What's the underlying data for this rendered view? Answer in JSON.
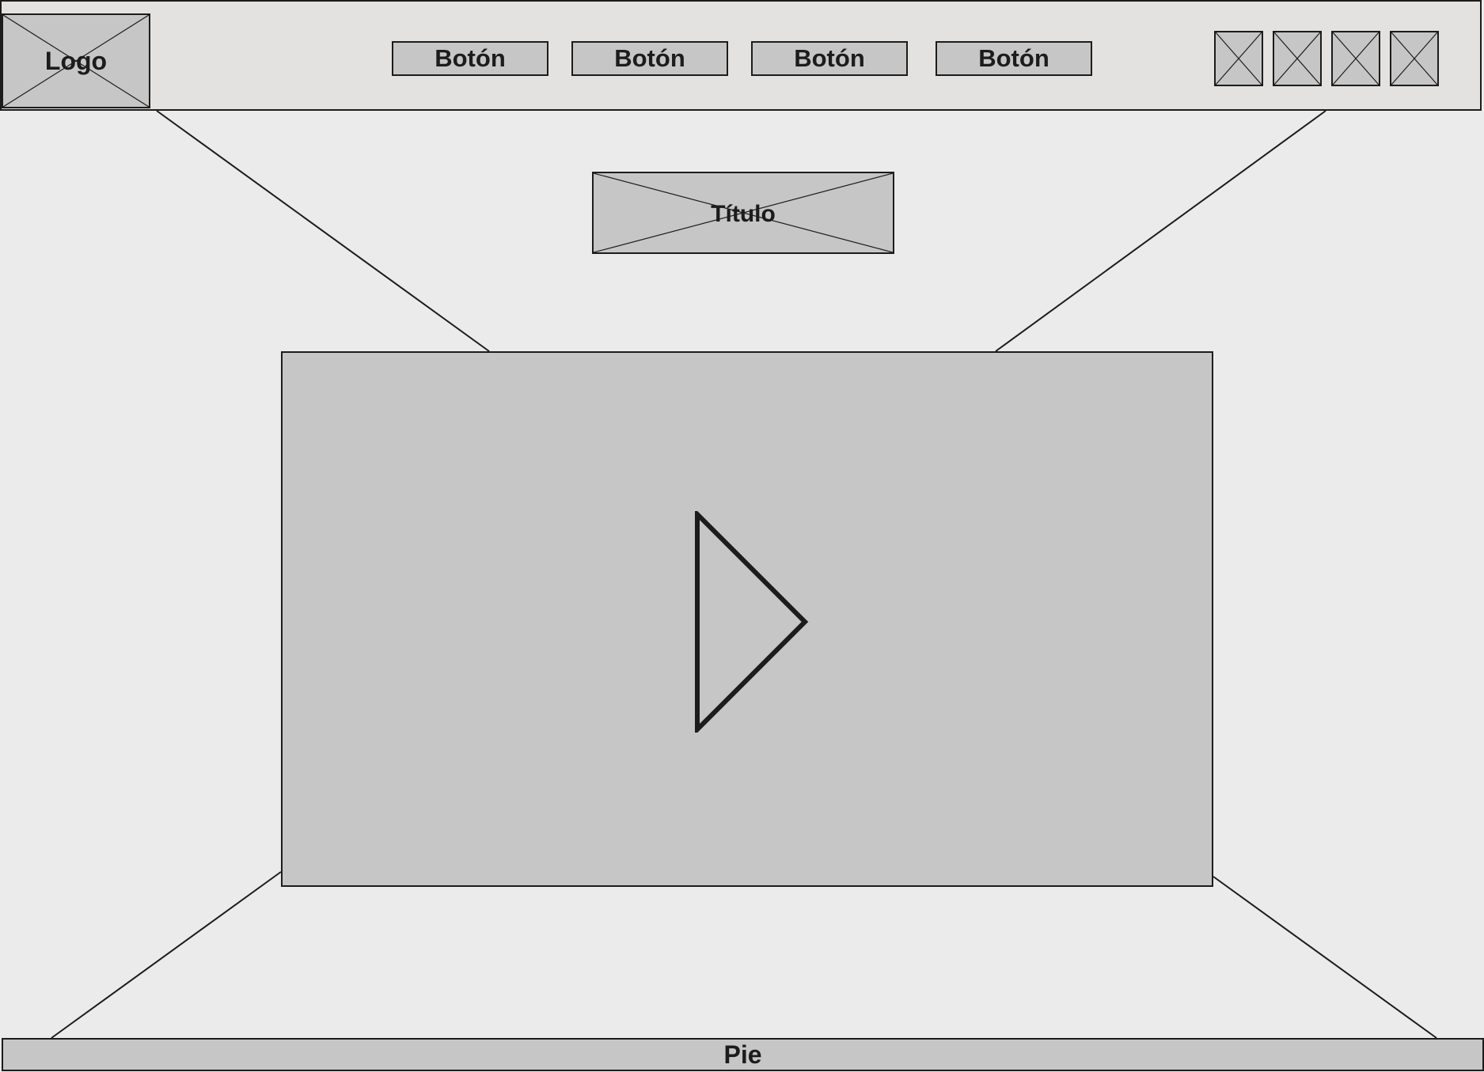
{
  "header": {
    "logo_label": "Logo",
    "nav_buttons": [
      {
        "label": "Botón"
      },
      {
        "label": "Botón"
      },
      {
        "label": "Botón"
      },
      {
        "label": "Botón"
      }
    ],
    "icon_placeholders": [
      "image-placeholder-icon",
      "image-placeholder-icon",
      "image-placeholder-icon",
      "image-placeholder-icon"
    ]
  },
  "main": {
    "title_label": "Título",
    "video": {
      "play_icon": "play-icon"
    }
  },
  "footer": {
    "label": "Pie"
  },
  "colors": {
    "background": "#ebebeb",
    "header_background": "#e3e2e0",
    "placeholder_fill": "#c6c6c6",
    "stroke": "#1c1c1c"
  }
}
